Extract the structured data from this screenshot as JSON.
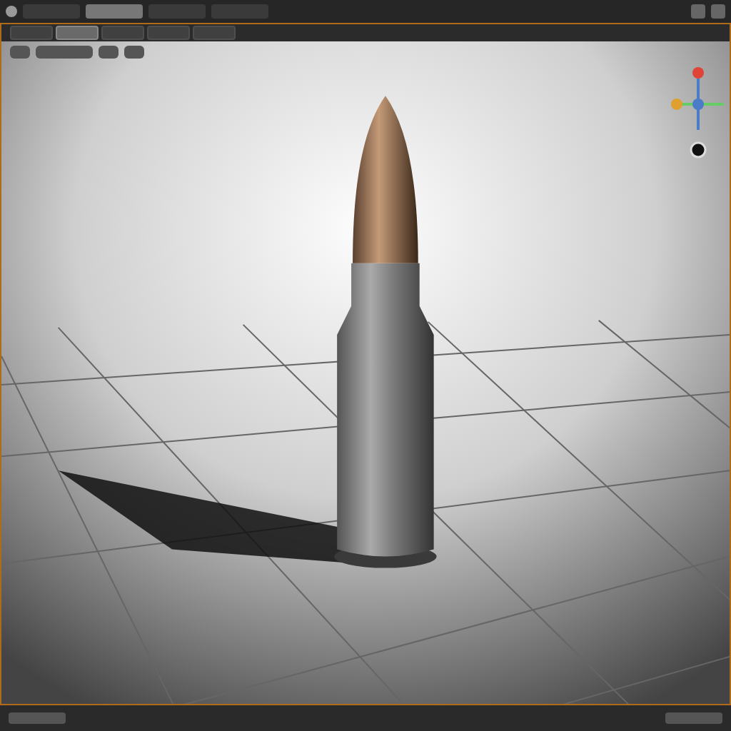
{
  "menu_bar": {
    "workspace_tabs": [
      {
        "selected": false
      },
      {
        "selected": true
      },
      {
        "selected": false
      },
      {
        "selected": false
      }
    ]
  },
  "editor_tabs": [
    {
      "selected": false
    },
    {
      "selected": true
    },
    {
      "selected": false
    },
    {
      "selected": false
    },
    {
      "selected": false
    }
  ],
  "gizmo": {
    "axes": [
      {
        "color": "#e04438"
      },
      {
        "color": "#e0a030"
      },
      {
        "color": "#4a7cc8"
      }
    ]
  }
}
